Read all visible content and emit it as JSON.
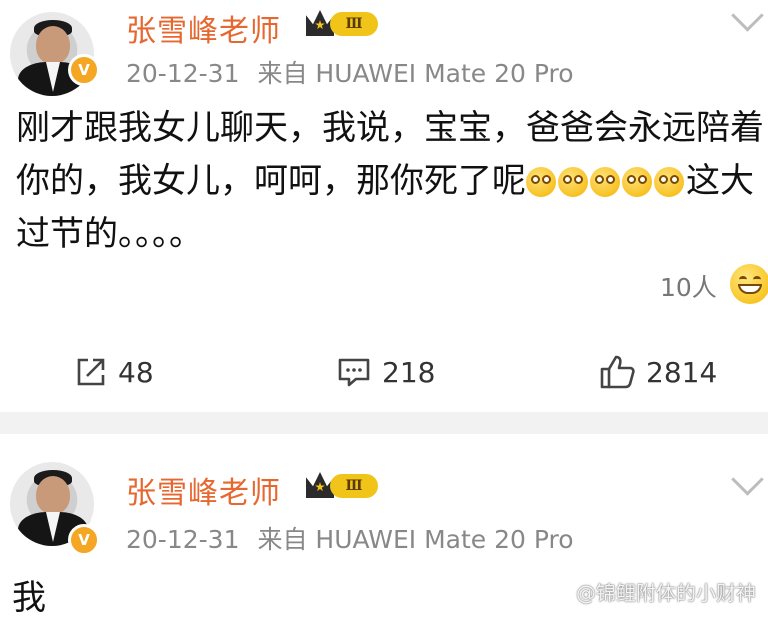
{
  "posts": [
    {
      "author": "张雪峰老师",
      "vip_level": "Ⅲ",
      "verified_mark": "V",
      "date": "20-12-31",
      "source": "来自 HUAWEI Mate 20 Pro",
      "text_line1": "刚才跟我女儿聊天，我说，宝宝，爸爸会永远陪着",
      "text_line2_a": "你的，我女儿，呵呵，那你死了呢",
      "text_line2_b": "这大",
      "text_line3": "过节的。。。。",
      "emoji_icon": "dizzy-face-emoji",
      "likers": "10人",
      "reposts": "48",
      "comments": "218",
      "likes": "2814"
    },
    {
      "author": "张雪峰老师",
      "vip_level": "Ⅲ",
      "verified_mark": "V",
      "date": "20-12-31",
      "source": "来自 HUAWEI Mate 20 Pro",
      "text": "我"
    }
  ],
  "watermark": "@锦鲤附体的小财神",
  "colors": {
    "author": "#e6672f",
    "meta": "#888888",
    "vip": "#f0c419",
    "badge": "#f5a623"
  }
}
